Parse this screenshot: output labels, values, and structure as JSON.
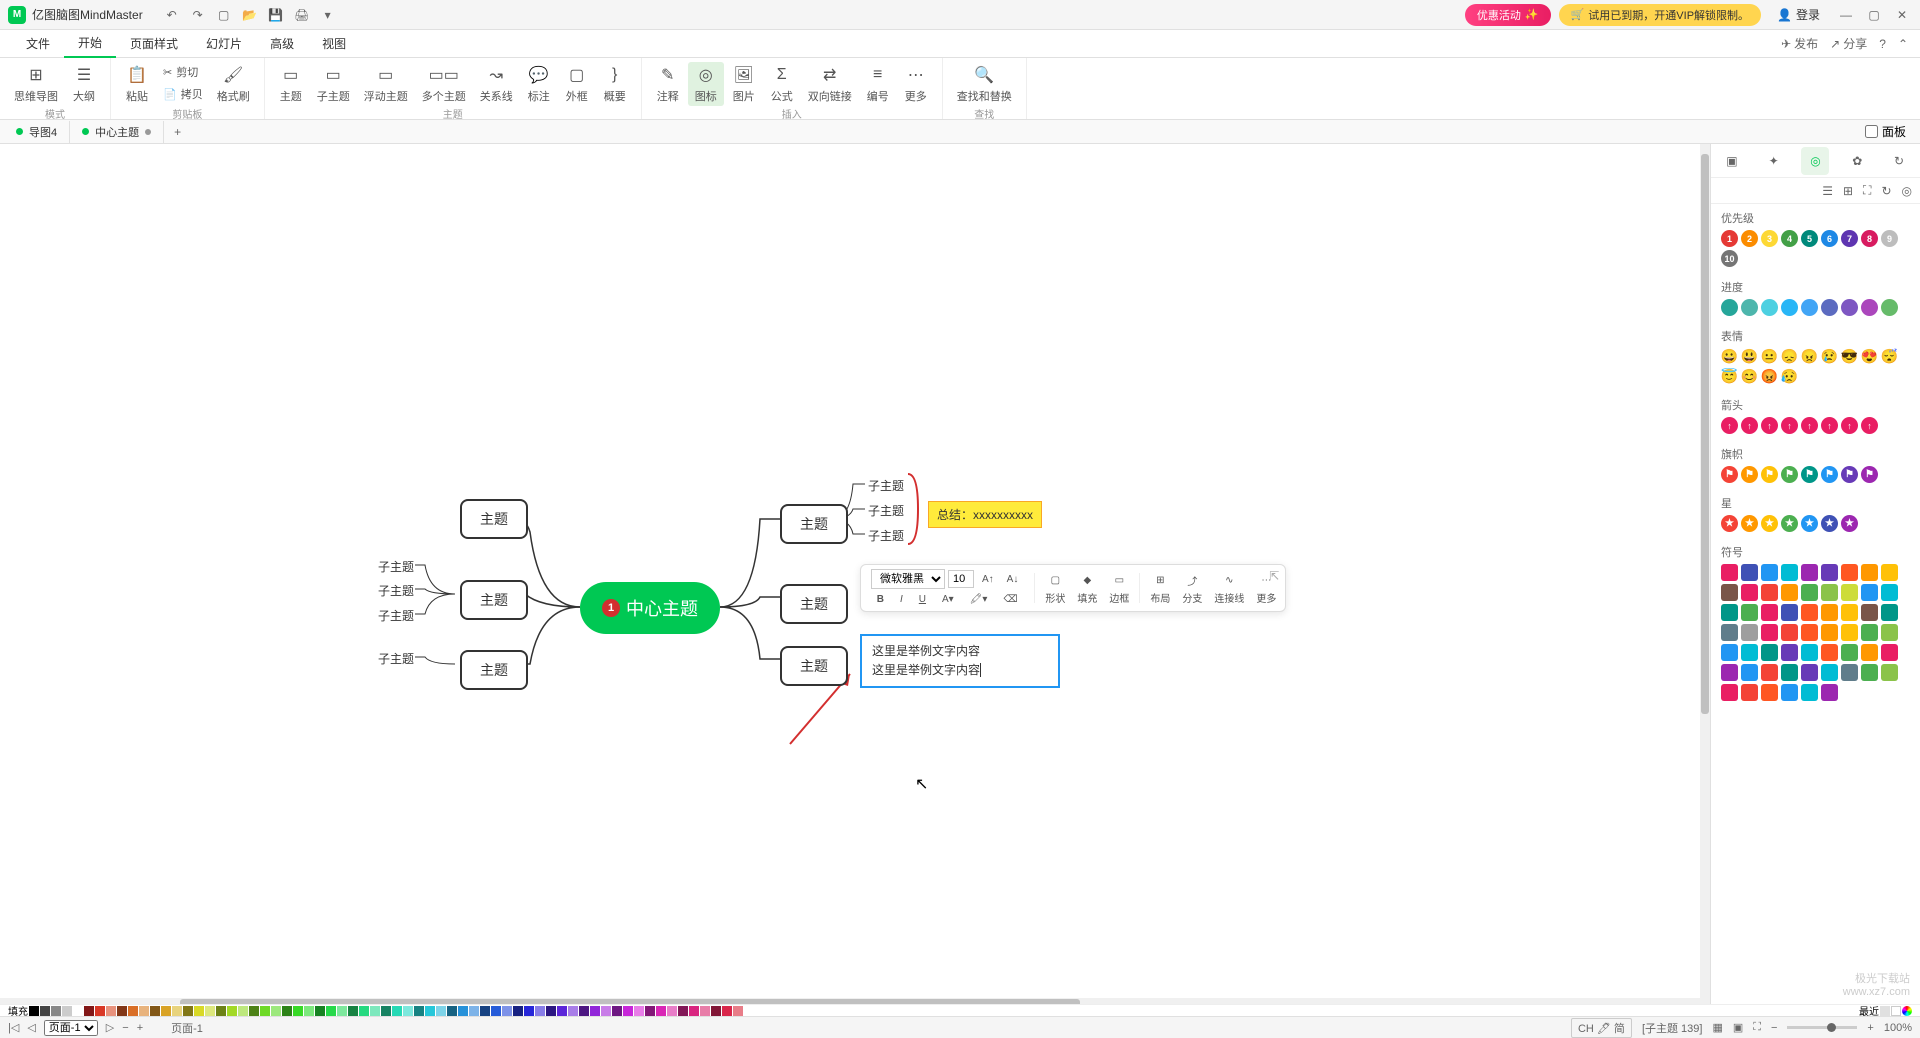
{
  "app": {
    "title": "亿图脑图MindMaster"
  },
  "titlebar": {
    "promo1": "优惠活动",
    "promo2": "试用已到期，开通VIP解锁限制。",
    "login": "登录"
  },
  "menu": {
    "items": [
      "文件",
      "开始",
      "页面样式",
      "幻灯片",
      "高级",
      "视图"
    ],
    "active": 1,
    "right": {
      "publish": "发布",
      "share": "分享"
    }
  },
  "ribbon": {
    "mode_group": "模式",
    "mode": {
      "mindmap": "思维导图",
      "outline": "大纲"
    },
    "clipboard_group": "剪贴板",
    "clipboard": {
      "paste": "粘贴",
      "cut": "剪切",
      "copy": "拷贝",
      "fmt": "格式刷"
    },
    "topic_group": "主题",
    "topic": {
      "topic": "主题",
      "subtopic": "子主题",
      "float": "浮动主题",
      "multi": "多个主题",
      "relation": "关系线",
      "callout": "标注",
      "boundary": "外框",
      "summary": "概要"
    },
    "insert_group": "插入",
    "insert": {
      "note": "注释",
      "icon": "图标",
      "image": "图片",
      "formula": "公式",
      "hyperlink": "双向链接",
      "number": "编号",
      "more": "更多"
    },
    "find_group": "查找",
    "find": {
      "find_replace": "查找和替换"
    }
  },
  "tabs": {
    "tab1": "导图4",
    "tab2": "中心主题",
    "panel_toggle": "面板"
  },
  "mindmap": {
    "central": "中心主题",
    "priority_badge": "1",
    "topic_left_1": "主题",
    "topic_left_2": "主题",
    "topic_left_3": "主题",
    "sub_l_1a": "子主题",
    "sub_l_1b": "子主题",
    "sub_l_1c": "子主题",
    "sub_l_3a": "子主题",
    "topic_right_1": "主题",
    "topic_right_2": "主题",
    "topic_right_3": "主题",
    "sub_r_1a": "子主题",
    "sub_r_1b": "子主题",
    "sub_r_1c": "子主题",
    "note": "总结：xxxxxxxxxx",
    "edit_line1": "这里是举例文字内容",
    "edit_line2": "这里是举例文字内容"
  },
  "float_toolbar": {
    "font": "微软雅黑",
    "size": "10",
    "bold": "B",
    "italic": "I",
    "underline": "U",
    "shape": "形状",
    "fill": "填充",
    "border": "边框",
    "layout": "布局",
    "branch": "分支",
    "connector": "连接线",
    "more": "更多"
  },
  "right_panel": {
    "sections": {
      "priority": "优先级",
      "progress": "进度",
      "emoji": "表情",
      "arrow": "箭头",
      "flag": "旗帜",
      "star": "星",
      "symbol": "符号"
    },
    "priority_nums": [
      "1",
      "2",
      "3",
      "4",
      "5",
      "6",
      "7",
      "8",
      "9",
      "10"
    ],
    "priority_colors": [
      "#e53935",
      "#fb8c00",
      "#fdd835",
      "#43a047",
      "#00897b",
      "#1e88e5",
      "#5e35b1",
      "#d81b60",
      "#bdbdbd",
      "#757575"
    ],
    "progress_colors": [
      "#26a69a",
      "#4db6ac",
      "#4dd0e1",
      "#29b6f6",
      "#42a5f5",
      "#5c6bc0",
      "#7e57c2",
      "#ab47bc",
      "#66bb6a"
    ],
    "emoji_list": [
      "😀",
      "😃",
      "😐",
      "😞",
      "😠",
      "😢",
      "😎",
      "😍",
      "😴",
      "😇",
      "😊",
      "😡",
      "😥"
    ],
    "arrow_colors": [
      "#e91e63",
      "#e91e63",
      "#e91e63",
      "#e91e63",
      "#e91e63",
      "#e91e63",
      "#e91e63",
      "#e91e63"
    ],
    "flag_colors": [
      "#f44336",
      "#ff9800",
      "#ffc107",
      "#4caf50",
      "#009688",
      "#2196f3",
      "#673ab7",
      "#9c27b0"
    ],
    "star_colors": [
      "#f44336",
      "#ff9800",
      "#ffc107",
      "#4caf50",
      "#2196f3",
      "#3f51b5",
      "#9c27b0"
    ],
    "symbol_colors": [
      "#e91e63",
      "#3f51b5",
      "#2196f3",
      "#00bcd4",
      "#9c27b0",
      "#673ab7",
      "#ff5722",
      "#ff9800",
      "#ffc107",
      "#795548",
      "#e91e63",
      "#f44336",
      "#ff9800",
      "#4caf50",
      "#8bc34a",
      "#cddc39",
      "#2196f3",
      "#00bcd4",
      "#009688",
      "#4caf50",
      "#e91e63",
      "#3f51b5",
      "#ff5722",
      "#ff9800",
      "#ffc107",
      "#795548",
      "#009688",
      "#607d8b",
      "#9e9e9e",
      "#e91e63",
      "#f44336",
      "#ff5722",
      "#ff9800",
      "#ffc107",
      "#4caf50",
      "#8bc34a",
      "#2196f3",
      "#00bcd4",
      "#009688",
      "#673ab7",
      "#00bcd4",
      "#ff5722",
      "#4caf50",
      "#ff9800",
      "#e91e63",
      "#9c27b0",
      "#2196f3",
      "#f44336",
      "#009688",
      "#673ab7",
      "#00bcd4",
      "#607d8b",
      "#4caf50",
      "#8bc34a",
      "#e91e63",
      "#f44336",
      "#ff5722",
      "#2196f3",
      "#00bcd4",
      "#9c27b0"
    ]
  },
  "color_strip": {
    "label_fill": "填充",
    "label_recent": "最近"
  },
  "status": {
    "page_select": "页面-1",
    "page_label": "页面-1",
    "ime": "CH 🖊 简",
    "selection": "[子主题 139]",
    "zoom": "100%"
  },
  "watermark": {
    "line1": "极光下载站",
    "line2": "www.xz7.com"
  }
}
